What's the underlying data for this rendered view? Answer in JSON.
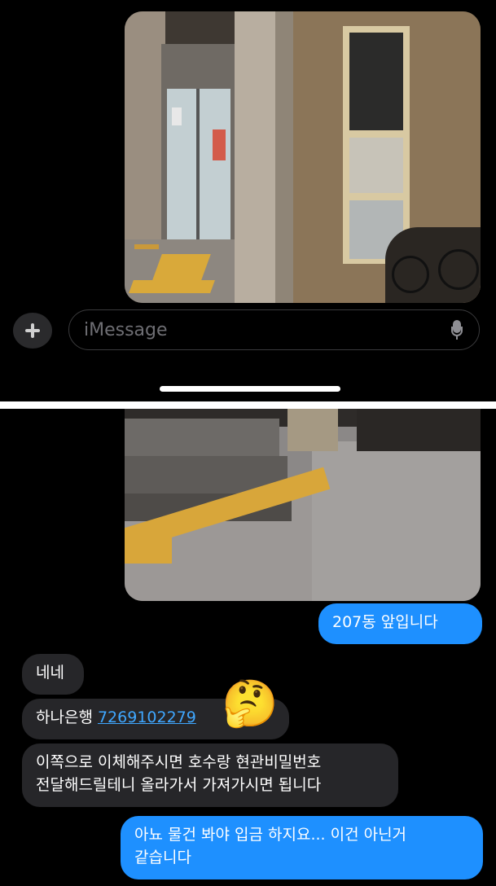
{
  "composer": {
    "placeholder": "iMessage"
  },
  "messages": {
    "sent_1": "207동 앞입니다",
    "recv_1": "네네",
    "recv_2_bank": "하나은행",
    "recv_2_account": "7269102279",
    "recv_2_emoji": "🤔",
    "recv_3": "이쪽으로 이체해주시면 호수랑 현관비밀번호\n전달해드릴테니 올라가서 가져가시면 됩니다",
    "sent_2": "아뇨 물건 봐야 입금 하지요... 이건 아닌거\n같습니다"
  },
  "colors": {
    "sent_bubble": "#1e90ff",
    "received_bubble": "#262629",
    "link": "#3fa7ff",
    "background": "#000000"
  }
}
